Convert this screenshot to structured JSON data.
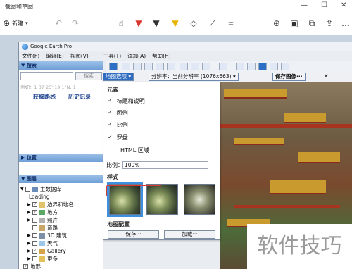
{
  "app": {
    "title": "截图和草图",
    "new_label": "新建"
  },
  "toolbar_icons": [
    "touch-write-icon",
    "ballpoint-pen-icon",
    "pencil-icon",
    "highlighter-icon",
    "eraser-icon",
    "ruler-icon",
    "crop-icon",
    "zoom-in-icon",
    "save-icon",
    "copy-icon",
    "share-icon",
    "more-icon"
  ],
  "ge": {
    "window_title": "Google Earth Pro",
    "menu": [
      "文件(F)",
      "编辑(E)",
      "视图(V)",
      "工具(T)",
      "添加(A)",
      "帮助(H)"
    ],
    "left": {
      "search_header": "▼ 搜索",
      "search_btn": "搜索",
      "coords": "例如：1 37 25' 19.1\"N, 1",
      "link_route": "获取路线",
      "link_history": "历史记录",
      "places_header": "▶ 位置",
      "layers_header": "▼ 图层",
      "layers": [
        {
          "label": "主数据库",
          "check": ""
        },
        {
          "label": "Loading",
          "check": ""
        },
        {
          "label": "边界和地名",
          "check": "✓"
        },
        {
          "label": "地方",
          "check": "✓"
        },
        {
          "label": "照片",
          "check": ""
        },
        {
          "label": "道路",
          "check": ""
        },
        {
          "label": "3D 建筑",
          "check": ""
        },
        {
          "label": "天气",
          "check": ""
        },
        {
          "label": "Gallery",
          "check": "✓"
        },
        {
          "label": "更多",
          "check": ""
        },
        {
          "label": "地形",
          "check": "✓"
        }
      ]
    },
    "optbar": {
      "map_options": "地图选项 ▾",
      "resolution": "分辨率：当前分辨率 (1076x663) ▾",
      "save_image": "保存图像···",
      "close": "×"
    },
    "dropdown": {
      "elements_title": "元素",
      "items": [
        {
          "check": "✓",
          "label": "标题和说明"
        },
        {
          "check": "✓",
          "label": "图例"
        },
        {
          "check": "✓",
          "label": "比例"
        },
        {
          "check": "✓",
          "label": "罗盘"
        },
        {
          "check": "",
          "label": "HTML 区域"
        }
      ],
      "scale_label": "比例：",
      "scale_value": "100%",
      "style_title": "样式",
      "config_title": "地图配置",
      "save_btn": "保存···",
      "load_btn": "加载···"
    }
  },
  "watermark": "软件技巧"
}
